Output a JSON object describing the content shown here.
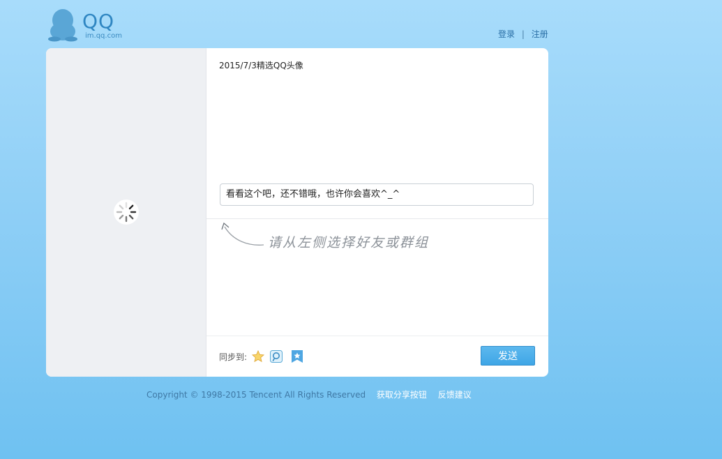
{
  "header": {
    "logo_text": "QQ",
    "logo_sub": "im.qq.com",
    "login_label": "登录",
    "separator": "|",
    "register_label": "注册"
  },
  "share": {
    "title": "2015/7/3精选QQ头像",
    "message": "看看这个吧，还不错哦，也许你会喜欢^_^",
    "hint": "请从左侧选择好友或群组",
    "sync_label": "同步到:",
    "sync_targets": [
      "qzone-star-icon",
      "tencent-weibo-icon",
      "favorites-icon"
    ],
    "send_label": "发送"
  },
  "footer": {
    "copyright": "Copyright © 1998-2015 Tencent All Rights Reserved",
    "get_button_link": "获取分享按钮",
    "feedback_link": "反馈建议"
  },
  "colors": {
    "accent": "#3fa6e6",
    "background_top": "#a8dcfb",
    "background_bottom": "#6fc1f1"
  }
}
